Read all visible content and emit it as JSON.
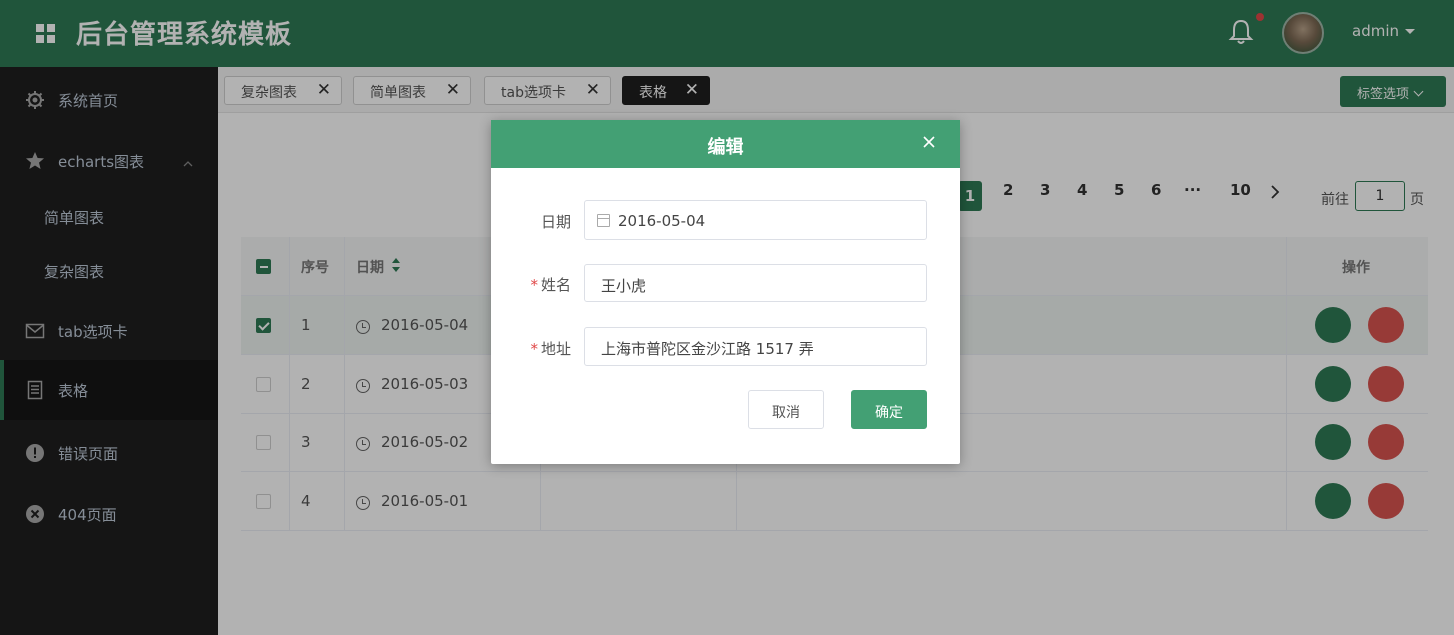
{
  "header": {
    "title": "后台管理系统模板",
    "username": "admin"
  },
  "sidebar": {
    "items": [
      {
        "label": "系统首页",
        "icon": "gear-icon"
      },
      {
        "label": "echarts图表",
        "icon": "star-icon"
      },
      {
        "label": "简单图表"
      },
      {
        "label": "复杂图表"
      },
      {
        "label": "tab选项卡",
        "icon": "mail-icon"
      },
      {
        "label": "表格",
        "icon": "document-icon"
      },
      {
        "label": "错误页面",
        "icon": "warning-icon"
      },
      {
        "label": "404页面",
        "icon": "close-circle-icon"
      }
    ],
    "active": "表格"
  },
  "tags": [
    {
      "label": "复杂图表"
    },
    {
      "label": "简单图表"
    },
    {
      "label": "tab选项卡"
    },
    {
      "label": "表格"
    }
  ],
  "tag_options_label": "标签选项",
  "pagination": {
    "current": "1",
    "pages": [
      "2",
      "3",
      "4",
      "5",
      "6",
      "···",
      "10"
    ],
    "goto_prefix": "前往",
    "goto_value": "1",
    "goto_suffix": "页"
  },
  "table": {
    "headers": {
      "index": "序号",
      "date": "日期",
      "actions": "操作"
    },
    "rows": [
      {
        "index": "1",
        "date": "2016-05-04",
        "checked": true
      },
      {
        "index": "2",
        "date": "2016-05-03",
        "checked": false
      },
      {
        "index": "3",
        "date": "2016-05-02",
        "checked": false
      },
      {
        "index": "4",
        "date": "2016-05-01",
        "checked": false
      }
    ]
  },
  "dialog": {
    "title": "编辑",
    "date_label": "日期",
    "date_value": "2016-05-04",
    "name_label": "姓名",
    "name_value": "王小虎",
    "address_label": "地址",
    "address_value": "上海市普陀区金沙江路 1517 弄",
    "cancel_label": "取消",
    "confirm_label": "确定"
  },
  "colors": {
    "brand": "#2f7a55",
    "dialog_header": "#43a074",
    "danger": "#d9534f"
  }
}
